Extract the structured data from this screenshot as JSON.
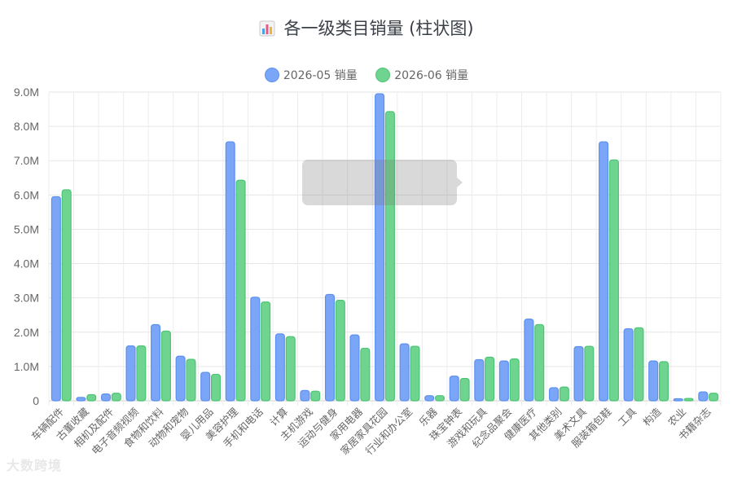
{
  "title": "各一级类目销量 (柱状图)",
  "title_icon": "bar-chart-emoji-icon",
  "watermark": "大数跨境",
  "chart_data": {
    "type": "bar",
    "categories": [
      "车辆配件",
      "古董收藏",
      "相机及配件",
      "电子音频视频",
      "食物和饮料",
      "动物和宠物",
      "婴儿用品",
      "美容护理",
      "手机和电话",
      "计算",
      "主机游戏",
      "运动与健身",
      "家用电器",
      "家居家具花园",
      "行业和办公室",
      "乐器",
      "珠宝钟表",
      "游戏和玩具",
      "纪念品聚会",
      "健康医疗",
      "其他类别",
      "美术文具",
      "服装箱包鞋",
      "工具",
      "构造",
      "农业",
      "书籍杂志"
    ],
    "series": [
      {
        "name": "2026-05 销量",
        "color": "#7ba6f7",
        "border": "#5b8ff0",
        "values": [
          5.95,
          0.1,
          0.2,
          1.6,
          2.22,
          1.3,
          0.83,
          7.55,
          3.02,
          1.95,
          0.3,
          3.1,
          1.92,
          8.95,
          1.66,
          0.15,
          0.72,
          1.2,
          1.16,
          2.38,
          0.38,
          1.58,
          7.55,
          2.1,
          1.16,
          0.06,
          0.26
        ]
      },
      {
        "name": "2026-06 销量",
        "color": "#6ed48f",
        "border": "#4cc474",
        "values": [
          6.15,
          0.18,
          0.22,
          1.6,
          2.03,
          1.21,
          0.77,
          6.43,
          2.88,
          1.87,
          0.28,
          2.93,
          1.53,
          8.43,
          1.59,
          0.15,
          0.65,
          1.27,
          1.22,
          2.22,
          0.4,
          1.59,
          7.02,
          2.13,
          1.14,
          0.07,
          0.22
        ]
      }
    ],
    "y_ticks": [
      "0",
      "1.0M",
      "2.0M",
      "3.0M",
      "4.0M",
      "5.0M",
      "6.0M",
      "7.0M",
      "8.0M",
      "9.0M"
    ],
    "unit": "M",
    "ylim": [
      0,
      9
    ],
    "grid": true,
    "legend_position": "top-center"
  }
}
